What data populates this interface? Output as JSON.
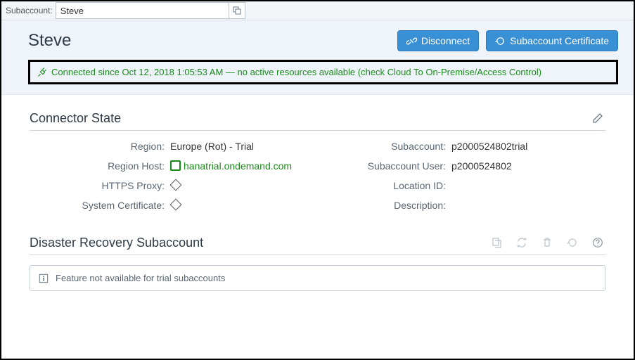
{
  "topbar": {
    "label": "Subaccount:",
    "value": "Steve"
  },
  "header": {
    "title": "Steve",
    "disconnect": "Disconnect",
    "cert": "Subaccount Certificate",
    "status": "Connected since Oct 12, 2018 1:05:53 AM — no active resources available (check Cloud To On-Premise/Access Control)"
  },
  "connector": {
    "title": "Connector State",
    "labels": {
      "region": "Region:",
      "regionHost": "Region Host:",
      "httpsProxy": "HTTPS Proxy:",
      "sysCert": "System Certificate:",
      "subaccount": "Subaccount:",
      "subUser": "Subaccount User:",
      "locationId": "Location ID:",
      "description": "Description:"
    },
    "values": {
      "region": "Europe (Rot) - Trial",
      "regionHost": "hanatrial.ondemand.com",
      "subaccount": "p2000524802trial",
      "subUser": "p2000524802",
      "locationId": "",
      "description": ""
    }
  },
  "dr": {
    "title": "Disaster Recovery Subaccount",
    "info": "Feature not available for trial subaccounts"
  }
}
